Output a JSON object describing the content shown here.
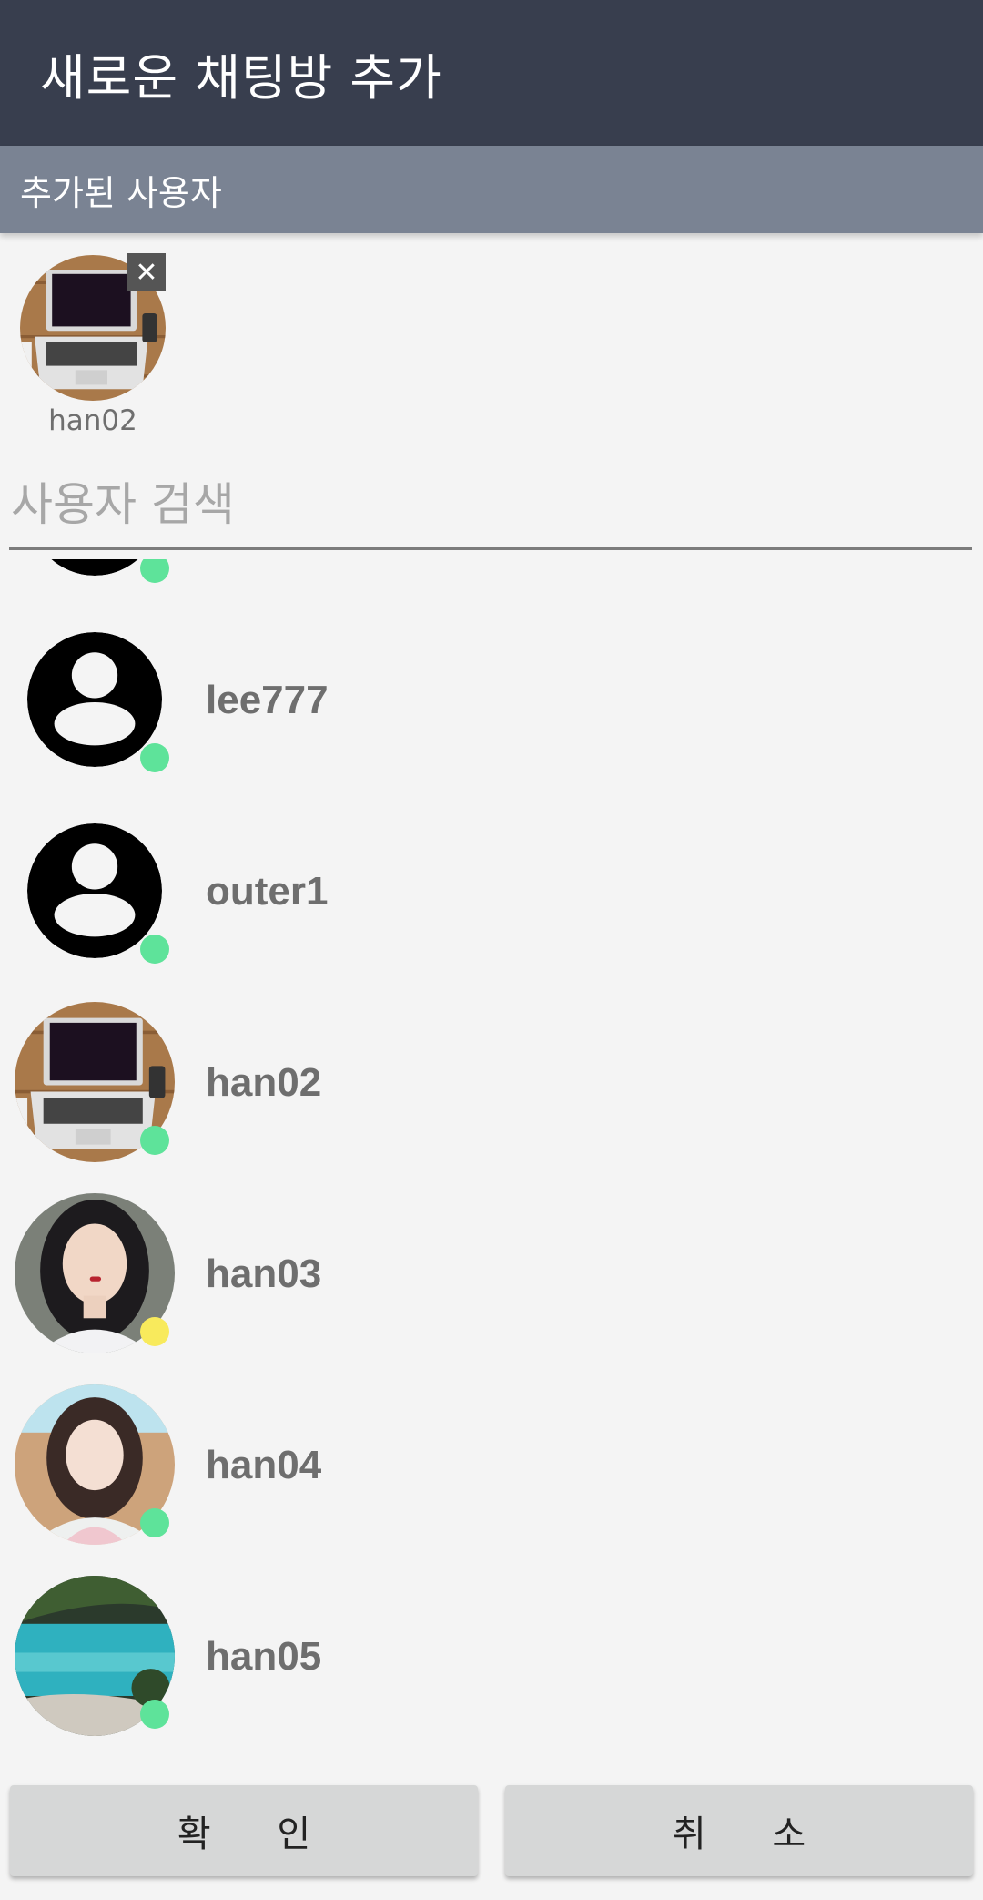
{
  "appbar": {
    "title": "새로운 채팅방 추가"
  },
  "selected_section": {
    "title": "추가된 사용자"
  },
  "selected_users": [
    {
      "name": "han02",
      "remove_icon": "close-icon",
      "avatar": "laptop-photo"
    }
  ],
  "search": {
    "placeholder": "사용자 검색",
    "value": ""
  },
  "users": [
    {
      "name": "",
      "avatar": "default-person-icon",
      "status": "online"
    },
    {
      "name": "lee777",
      "avatar": "default-person-icon",
      "status": "online"
    },
    {
      "name": "outer1",
      "avatar": "default-person-icon",
      "status": "online"
    },
    {
      "name": "han02",
      "avatar": "laptop-photo",
      "status": "online"
    },
    {
      "name": "han03",
      "avatar": "portrait-photo",
      "status": "away"
    },
    {
      "name": "han04",
      "avatar": "portrait-photo",
      "status": "online"
    },
    {
      "name": "han05",
      "avatar": "lake-photo",
      "status": "online"
    }
  ],
  "status_colors": {
    "online": "#5ee39a",
    "away": "#f8ea5c"
  },
  "buttons": {
    "confirm": "확 인",
    "cancel": "취 소"
  }
}
